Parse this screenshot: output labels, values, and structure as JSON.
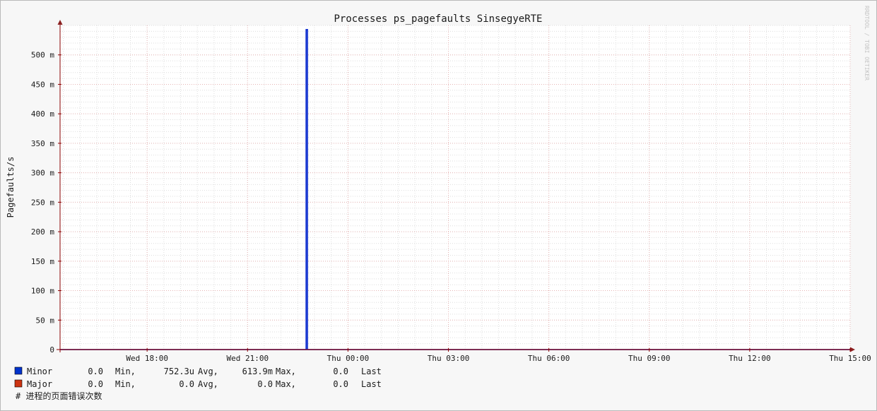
{
  "watermark": "RRDTOOL / TOBI OETIKER",
  "chart_data": {
    "type": "line",
    "title": "Processes ps_pagefaults SinsegyeRTE",
    "ylabel": "Pagefaults/s",
    "ylim": [
      0,
      0.55
    ],
    "y_ticks": [
      0,
      0.05,
      0.1,
      0.15,
      0.2,
      0.25,
      0.3,
      0.35,
      0.4,
      0.45,
      0.5
    ],
    "y_tick_labels": [
      "0",
      "50 m",
      "100 m",
      "150 m",
      "200 m",
      "250 m",
      "300 m",
      "350 m",
      "400 m",
      "450 m",
      "500 m"
    ],
    "x_unit": "hours",
    "xlim": [
      15.4,
      39.0
    ],
    "x_ticks": [
      18,
      21,
      24,
      27,
      30,
      33,
      36,
      39
    ],
    "x_tick_labels": [
      "Wed 18:00",
      "Wed 21:00",
      "Thu 00:00",
      "Thu 03:00",
      "Thu 06:00",
      "Thu 09:00",
      "Thu 12:00",
      "Thu 15:00"
    ],
    "grid": true,
    "series": [
      {
        "name": "Minor",
        "color": "#0022cc",
        "points": [
          [
            15.4,
            0
          ],
          [
            22.75,
            0
          ],
          [
            22.75,
            0.5429
          ],
          [
            22.79,
            0.5429
          ],
          [
            22.79,
            0
          ],
          [
            39.0,
            0
          ]
        ]
      },
      {
        "name": "Major",
        "color": "#cc3311",
        "points": [
          [
            15.4,
            0
          ],
          [
            39.0,
            0
          ]
        ]
      }
    ],
    "legend": {
      "position": "bottom",
      "rows": [
        {
          "name": "Minor",
          "color": "#0033cc",
          "min": "0.0",
          "min_label": "Min,",
          "avg": "752.3u",
          "avg_label": "Avg,",
          "max": "613.9m",
          "max_label": "Max,",
          "last": "0.0",
          "last_label": "Last"
        },
        {
          "name": "Major",
          "color": "#cc3311",
          "min": "0.0",
          "min_label": "Min,",
          "avg": "0.0",
          "avg_label": "Avg,",
          "max": "0.0",
          "max_label": "Max,",
          "last": "0.0",
          "last_label": "Last"
        }
      ],
      "comment": "# 进程的页面错误次数"
    }
  }
}
